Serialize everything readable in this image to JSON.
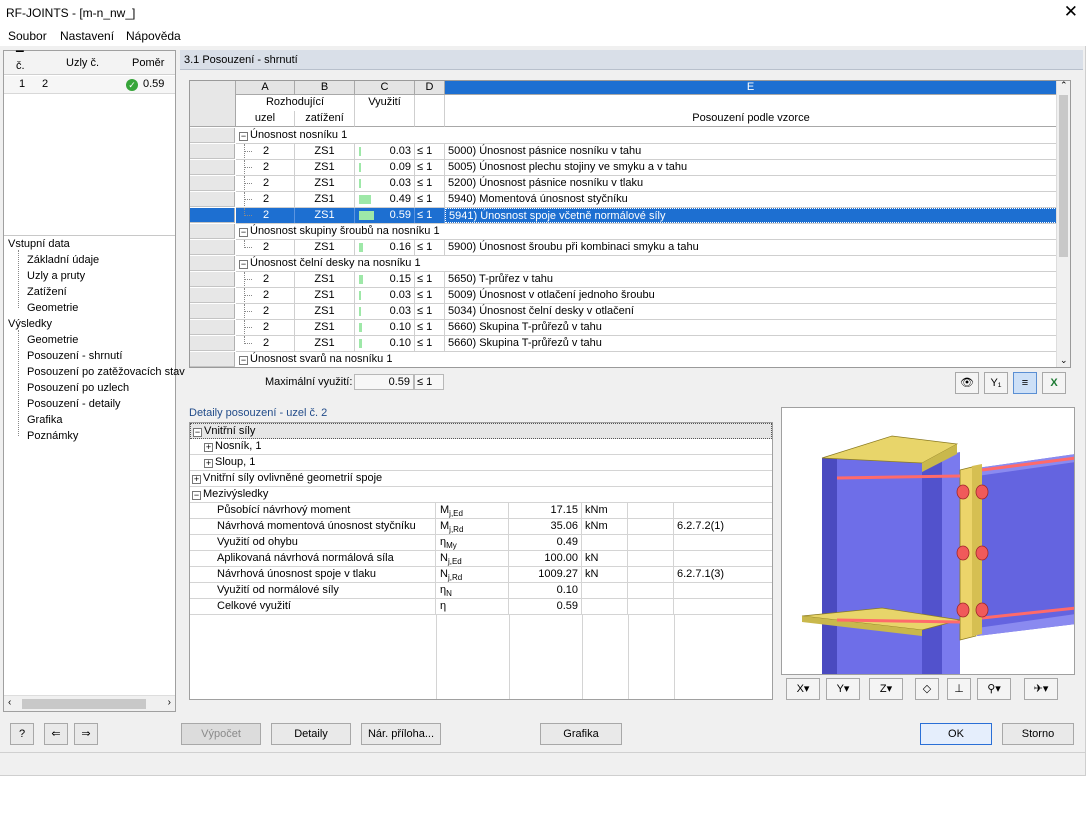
{
  "window": {
    "title": "RF-JOINTS - [m-n_nw_]",
    "close": "✕"
  },
  "menu": [
    "Soubor",
    "Nastavení",
    "Nápověda"
  ],
  "left_table": {
    "headers": [
      "č.",
      "Uzly č.",
      "Poměr"
    ],
    "rows": [
      {
        "no": "1",
        "nodes": "2",
        "ratio": "0.59"
      }
    ]
  },
  "tree": {
    "input_label": "Vstupní data",
    "input_items": [
      "Základní údaje",
      "Uzly a pruty",
      "Zatížení",
      "Geometrie"
    ],
    "results_label": "Výsledky",
    "results_items": [
      "Geometrie",
      "Posouzení - shrnutí",
      "Posouzení po zatěžovacích stav",
      "Posouzení po uzlech",
      "Posouzení - detaily",
      "Grafika",
      "Poznámky"
    ]
  },
  "section_title": "3.1 Posouzení - shrnutí",
  "grid": {
    "col_letters": [
      "A",
      "B",
      "C",
      "D",
      "E"
    ],
    "sub1": {
      "a": "Rozhodující",
      "c": "Využití"
    },
    "sub2": {
      "a": "uzel",
      "b": "zatížení",
      "e": "Posouzení podle vzorce"
    },
    "groups": [
      {
        "title": "Únosnost nosníku 1",
        "rows": [
          {
            "node": "2",
            "load": "ZS1",
            "ratio": "0.03",
            "le": "≤ 1",
            "desc": "5000) Únosnost pásnice nosníku v tahu",
            "util": 0.03
          },
          {
            "node": "2",
            "load": "ZS1",
            "ratio": "0.09",
            "le": "≤ 1",
            "desc": "5005) Únosnost plechu stojiny ve smyku a v tahu",
            "util": 0.09
          },
          {
            "node": "2",
            "load": "ZS1",
            "ratio": "0.03",
            "le": "≤ 1",
            "desc": "5200) Únosnost pásnice nosníku v tlaku",
            "util": 0.03
          },
          {
            "node": "2",
            "load": "ZS1",
            "ratio": "0.49",
            "le": "≤ 1",
            "desc": "5940) Momentová únosnost styčníku",
            "util": 0.49
          },
          {
            "node": "2",
            "load": "ZS1",
            "ratio": "0.59",
            "le": "≤ 1",
            "desc": "5941) Únosnost spoje včetně normálové síly",
            "util": 0.59,
            "selected": true
          }
        ]
      },
      {
        "title": "Únosnost skupiny šroubů na nosníku 1",
        "rows": [
          {
            "node": "2",
            "load": "ZS1",
            "ratio": "0.16",
            "le": "≤ 1",
            "desc": "5900) Únosnost šroubu při kombinaci smyku a tahu",
            "util": 0.16
          }
        ]
      },
      {
        "title": "Únosnost čelní desky na nosníku 1",
        "rows": [
          {
            "node": "2",
            "load": "ZS1",
            "ratio": "0.15",
            "le": "≤ 1",
            "desc": "5650) T-průřez v tahu",
            "util": 0.15
          },
          {
            "node": "2",
            "load": "ZS1",
            "ratio": "0.03",
            "le": "≤ 1",
            "desc": "5009) Únosnost v otlačení jednoho šroubu",
            "util": 0.03
          },
          {
            "node": "2",
            "load": "ZS1",
            "ratio": "0.03",
            "le": "≤ 1",
            "desc": "5034) Únosnost čelní desky v otlačení",
            "util": 0.03
          },
          {
            "node": "2",
            "load": "ZS1",
            "ratio": "0.10",
            "le": "≤ 1",
            "desc": "5660) Skupina T-průřezů v tahu",
            "util": 0.1
          },
          {
            "node": "2",
            "load": "ZS1",
            "ratio": "0.10",
            "le": "≤ 1",
            "desc": "5660) Skupina T-průřezů v tahu",
            "util": 0.1
          }
        ]
      },
      {
        "title": "Únosnost svarů na nosníku 1",
        "rows": []
      }
    ],
    "max_label": "Maximální využití:",
    "max_value": "0.59",
    "max_le": "≤ 1"
  },
  "details": {
    "title": "Detaily posouzení  -  uzel č. 2",
    "nodes": [
      {
        "label": "Vnitřní síly",
        "sign": "−",
        "level": 0
      },
      {
        "label": "Nosník, 1",
        "sign": "+",
        "level": 1
      },
      {
        "label": "Sloup, 1",
        "sign": "+",
        "level": 1
      },
      {
        "label": "Vnitřní síly ovlivněné geometrií spoje",
        "sign": "+",
        "level": 0
      },
      {
        "label": "Mezivýsledky",
        "sign": "−",
        "level": 0
      }
    ],
    "rows": [
      {
        "name": "Působící návrhový moment",
        "sym": "M",
        "sub": "j,Ed",
        "val": "17.15",
        "unit": "kNm",
        "ref": ""
      },
      {
        "name": "Návrhová momentová únosnost styčníku",
        "sym": "M",
        "sub": "j,Rd",
        "val": "35.06",
        "unit": "kNm",
        "ref": "6.2.7.2(1)"
      },
      {
        "name": "Využití od ohybu",
        "sym": "η",
        "sub": "My",
        "val": "0.49",
        "unit": "",
        "ref": ""
      },
      {
        "name": "Aplikovaná návrhová normálová síla",
        "sym": "N",
        "sub": "j,Ed",
        "val": "100.00",
        "unit": "kN",
        "ref": ""
      },
      {
        "name": "Návrhová únosnost spoje v tlaku",
        "sym": "N",
        "sub": "j,Rd",
        "val": "1009.27",
        "unit": "kN",
        "ref": "6.2.7.1(3)"
      },
      {
        "name": "Využití od normálové síly",
        "sym": "η",
        "sub": "N",
        "val": "0.10",
        "unit": "",
        "ref": ""
      },
      {
        "name": "Celkové využití",
        "sym": "η",
        "sub": "",
        "val": "0.59",
        "unit": "",
        "ref": ""
      }
    ]
  },
  "buttons": {
    "calc": "Výpočet",
    "details": "Detaily",
    "annex": "Nár. příloha...",
    "graphics": "Grafika",
    "ok": "OK",
    "cancel": "Storno"
  },
  "colors": {
    "selection": "#1d6fd1",
    "bar": "#9ee8a8",
    "ok_green": "#37a53a",
    "steel_blue": "#5f5fd6",
    "plate_yellow": "#e8d56a"
  }
}
